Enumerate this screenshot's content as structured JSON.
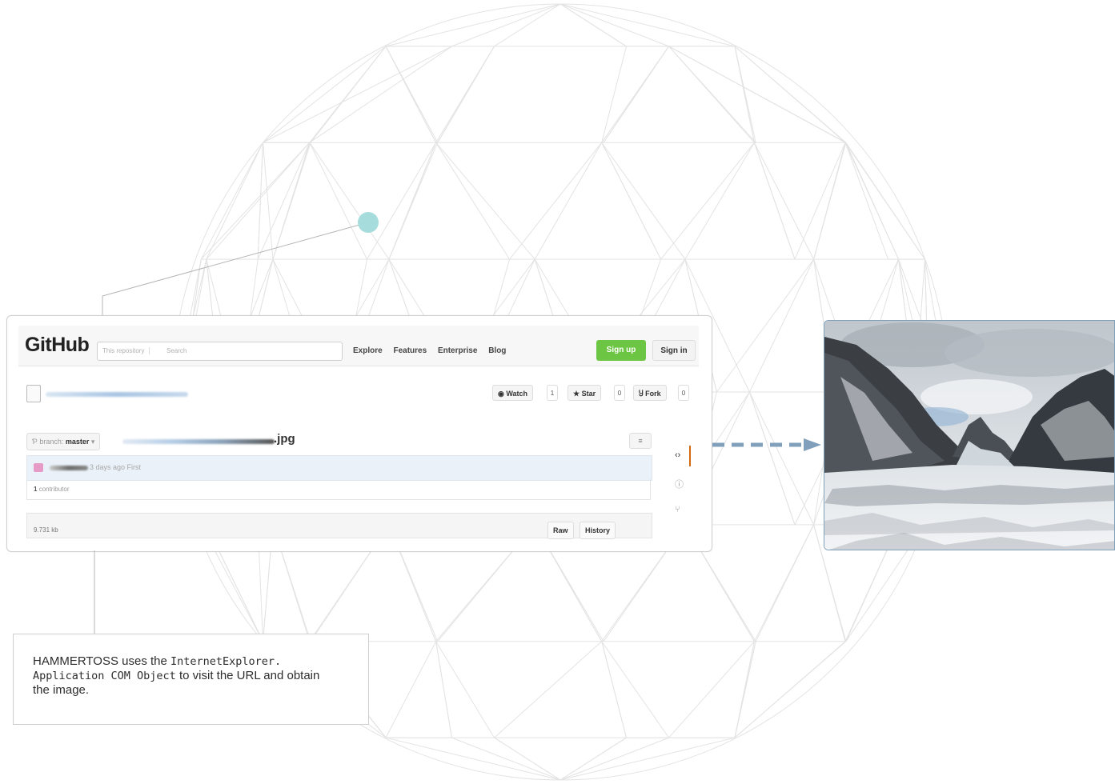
{
  "github": {
    "logo": "GitHub",
    "search_scope": "This repository",
    "search_placeholder": "Search",
    "nav": [
      "Explore",
      "Features",
      "Enterprise",
      "Blog"
    ],
    "signup_label": "Sign up",
    "signin_label": "Sign in",
    "watch_label": "Watch",
    "watch_count": "1",
    "star_label": "Star",
    "star_count": "0",
    "fork_label": "Fork",
    "fork_count": "0",
    "branch_prefix": "branch:",
    "branch_name": "master",
    "file_name": ".jpg",
    "commit_text": "3 days ago First",
    "contributors_count": "1",
    "contributors_label": "contributor",
    "file_size": "9.731 kb",
    "raw_label": "Raw",
    "history_label": "History"
  },
  "caption": {
    "text_1": "HAMMERTOSS uses the ",
    "code_1": "InternetExplorer.",
    "code_2": "Application COM Object",
    "text_2": " to visit the URL and obtain the image."
  },
  "colors": {
    "node_dot": "#a7dcdd",
    "arrow": "#7f9fbb",
    "signup_green": "#6cc644",
    "globe_line": "#e3e3e3"
  }
}
